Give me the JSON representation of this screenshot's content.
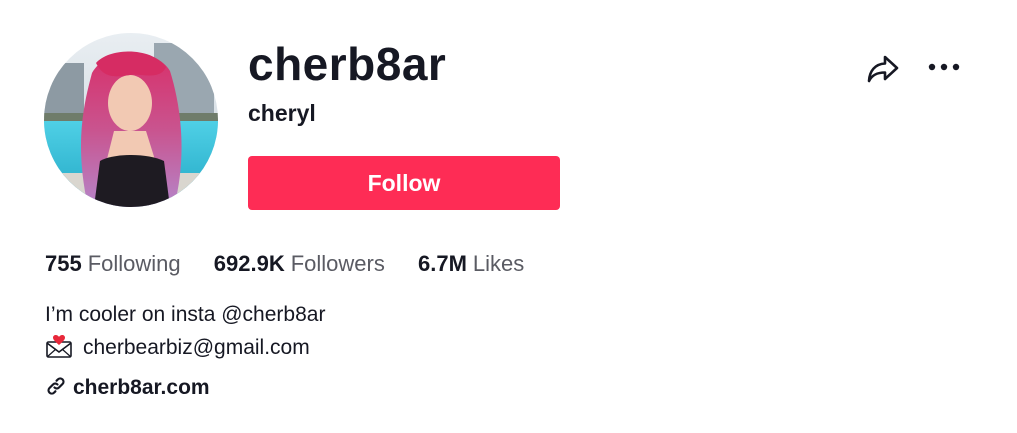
{
  "profile": {
    "username": "cherb8ar",
    "nickname": "cheryl",
    "avatar_icon": "profile-photo",
    "follow_label": "Follow"
  },
  "stats": {
    "following_count": "755",
    "following_label": "Following",
    "followers_count": "692.9K",
    "followers_label": "Followers",
    "likes_count": "6.7M",
    "likes_label": "Likes"
  },
  "bio": {
    "line1": "I’m cooler on insta @cherb8ar",
    "line2": "cherbearbiz@gmail.com",
    "line2_icon": "love-letter-icon"
  },
  "link": {
    "text": "cherb8ar.com",
    "icon": "link-icon"
  },
  "actions": {
    "share_icon": "share-icon",
    "more_icon": "more-icon"
  },
  "colors": {
    "accent": "#fe2c55",
    "text_primary": "#161823",
    "text_secondary": "#5a5b63"
  }
}
